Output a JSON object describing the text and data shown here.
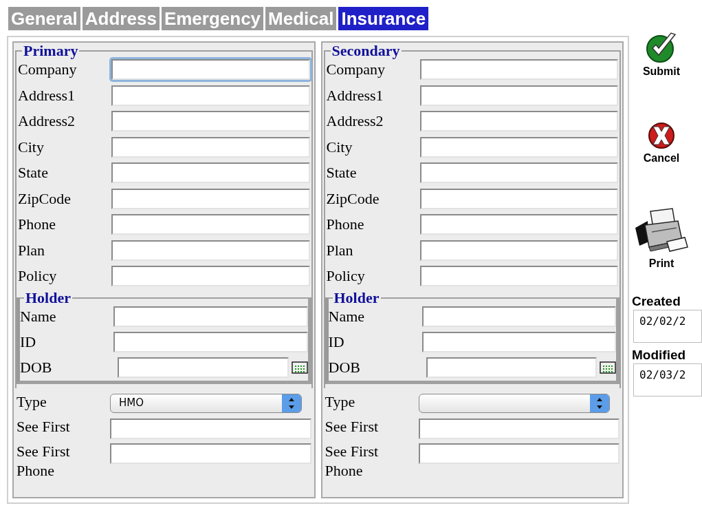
{
  "tabs": [
    {
      "label": "General",
      "selected": false
    },
    {
      "label": "Address",
      "selected": false
    },
    {
      "label": "Emergency",
      "selected": false
    },
    {
      "label": "Medical",
      "selected": false
    },
    {
      "label": "Insurance",
      "selected": true
    }
  ],
  "panels": [
    {
      "title": "Primary",
      "fields": [
        {
          "label": "Company",
          "focused": true
        },
        {
          "label": "Address1",
          "focused": false
        },
        {
          "label": "Address2",
          "focused": false
        },
        {
          "label": "City",
          "focused": false
        },
        {
          "label": "State",
          "focused": false
        },
        {
          "label": "ZipCode",
          "focused": false
        },
        {
          "label": "Phone",
          "focused": false
        },
        {
          "label": "Plan",
          "focused": false
        },
        {
          "label": "Policy",
          "focused": false
        }
      ],
      "holder": {
        "title": "Holder",
        "fields": [
          {
            "label": "Name",
            "kind": "text"
          },
          {
            "label": "ID",
            "kind": "text"
          },
          {
            "label": "DOB",
            "kind": "date"
          }
        ]
      },
      "extra_fields": [
        {
          "label": "Type",
          "kind": "select",
          "value": "HMO"
        },
        {
          "label": "See First",
          "kind": "text"
        },
        {
          "label": "See First Phone",
          "kind": "text"
        }
      ]
    },
    {
      "title": "Secondary",
      "fields": [
        {
          "label": "Company",
          "focused": false
        },
        {
          "label": "Address1",
          "focused": false
        },
        {
          "label": "Address2",
          "focused": false
        },
        {
          "label": "City",
          "focused": false
        },
        {
          "label": "State",
          "focused": false
        },
        {
          "label": "ZipCode",
          "focused": false
        },
        {
          "label": "Phone",
          "focused": false
        },
        {
          "label": "Plan",
          "focused": false
        },
        {
          "label": "Policy",
          "focused": false
        }
      ],
      "holder": {
        "title": "Holder",
        "fields": [
          {
            "label": "Name",
            "kind": "text"
          },
          {
            "label": "ID",
            "kind": "text"
          },
          {
            "label": "DOB",
            "kind": "date"
          }
        ]
      },
      "extra_fields": [
        {
          "label": "Type",
          "kind": "select"
        },
        {
          "label": "See First",
          "kind": "text"
        },
        {
          "label": "See First Phone",
          "kind": "text"
        }
      ]
    }
  ],
  "actions": [
    {
      "label": "Submit",
      "kind": "submit"
    },
    {
      "label": "Cancel",
      "kind": "cancel"
    },
    {
      "label": "Print",
      "kind": "print"
    }
  ],
  "meta": [
    {
      "label": "Created",
      "value": "02/02/2"
    },
    {
      "label": "Modified",
      "value": "02/03/2"
    }
  ]
}
